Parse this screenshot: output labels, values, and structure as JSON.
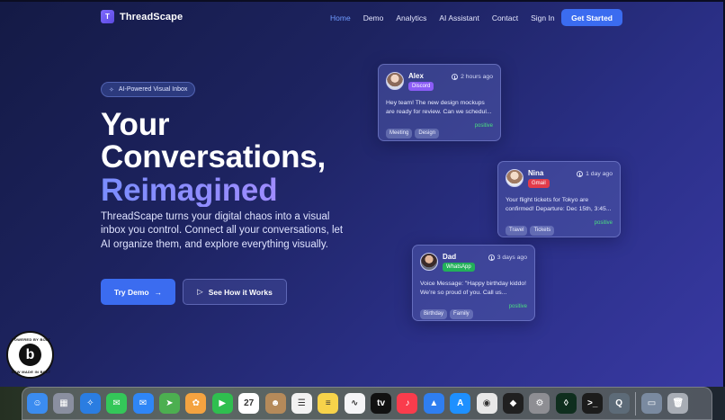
{
  "brand": {
    "name": "ThreadScape",
    "logo_letter": "T"
  },
  "nav": {
    "links": [
      {
        "label": "Home",
        "active": true
      },
      {
        "label": "Demo",
        "active": false
      },
      {
        "label": "Analytics",
        "active": false
      },
      {
        "label": "AI Assistant",
        "active": false
      },
      {
        "label": "Contact",
        "active": false
      },
      {
        "label": "Sign In",
        "active": false
      }
    ],
    "cta_label": "Get Started"
  },
  "hero": {
    "pill_label": "AI-Powered Visual Inbox",
    "headline_line1": "Your",
    "headline_line2": "Conversations,",
    "headline_line3": "Reimagined",
    "subtext": "ThreadScape turns your digital chaos into a visual inbox you control. Connect all your conversations, let AI organize them, and explore everything visually.",
    "primary_button": "Try Demo",
    "primary_arrow": "→",
    "secondary_button": "See How it Works",
    "secondary_icon": "▷"
  },
  "cards": [
    {
      "name": "Alex",
      "source": "Discord",
      "source_color": "#8b5cf6",
      "time": "2 hours ago",
      "message": "Hey team! The new design mockups are ready for review. Can we schedul...",
      "tags": [
        "Meeting",
        "Design"
      ],
      "sentiment": "positive"
    },
    {
      "name": "Nina",
      "source": "Gmail",
      "source_color": "#e23b4a",
      "time": "1 day ago",
      "message": "Your flight tickets for Tokyo are confirmed! Departure: Dec 15th, 3:45...",
      "tags": [
        "Travel",
        "Tickets"
      ],
      "sentiment": "positive"
    },
    {
      "name": "Dad",
      "source": "WhatsApp",
      "source_color": "#22b05a",
      "time": "3 days ago",
      "message": "Voice Message: \"Happy birthday kiddo! We're so proud of you. Call us...",
      "tags": [
        "Birthday",
        "Family"
      ],
      "sentiment": "positive"
    }
  ],
  "badge": {
    "text_top": "POWERED BY BOLT",
    "text_bottom": "NEW MADE IN BOLT",
    "letter": "b"
  },
  "dock": {
    "apps": [
      {
        "name": "finder-icon",
        "color": "#3b8cf0",
        "glyph": "☺"
      },
      {
        "name": "launchpad-icon",
        "color": "#8a8fa0",
        "glyph": "▦"
      },
      {
        "name": "safari-icon",
        "color": "#2a7de1",
        "glyph": "✧"
      },
      {
        "name": "messages-icon",
        "color": "#34c759",
        "glyph": "✉"
      },
      {
        "name": "mail-icon",
        "color": "#2f86f6",
        "glyph": "✉"
      },
      {
        "name": "maps-icon",
        "color": "#4caf50",
        "glyph": "➤"
      },
      {
        "name": "photos-icon",
        "color": "#f4a340",
        "glyph": "✿"
      },
      {
        "name": "facetime-icon",
        "color": "#2fbf4f",
        "glyph": "▶"
      },
      {
        "name": "calendar-icon",
        "color": "#ffffff",
        "glyph": "27"
      },
      {
        "name": "contacts-icon",
        "color": "#b58a5a",
        "glyph": "☻"
      },
      {
        "name": "reminders-icon",
        "color": "#f2f2f2",
        "glyph": "☰"
      },
      {
        "name": "notes-icon",
        "color": "#f7d34a",
        "glyph": "≡"
      },
      {
        "name": "freeform-icon",
        "color": "#f5f5f7",
        "glyph": "∿"
      },
      {
        "name": "apple-tv-icon",
        "color": "#111111",
        "glyph": "tv"
      },
      {
        "name": "music-icon",
        "color": "#fa3c4c",
        "glyph": "♪"
      },
      {
        "name": "keynote-icon",
        "color": "#2f7ef0",
        "glyph": "▲"
      },
      {
        "name": "app-store-icon",
        "color": "#1e90ff",
        "glyph": "A"
      },
      {
        "name": "chrome-icon",
        "color": "#e8e8e8",
        "glyph": "◉"
      },
      {
        "name": "cube-app-icon",
        "color": "#202020",
        "glyph": "◆"
      },
      {
        "name": "system-settings-icon",
        "color": "#8e8e93",
        "glyph": "⚙"
      },
      {
        "name": "mongodb-compass-icon",
        "color": "#0f2e1e",
        "glyph": "◊"
      },
      {
        "name": "terminal-icon",
        "color": "#1c1c1c",
        "glyph": ">_"
      },
      {
        "name": "quicktime-icon",
        "color": "#5d6b78",
        "glyph": "Q"
      }
    ],
    "right_items": [
      {
        "name": "downloads-stack-icon",
        "color": "#7a8aa0",
        "glyph": "▭"
      },
      {
        "name": "trash-icon",
        "color": "#a8adb5",
        "glyph": "🗑"
      }
    ]
  }
}
